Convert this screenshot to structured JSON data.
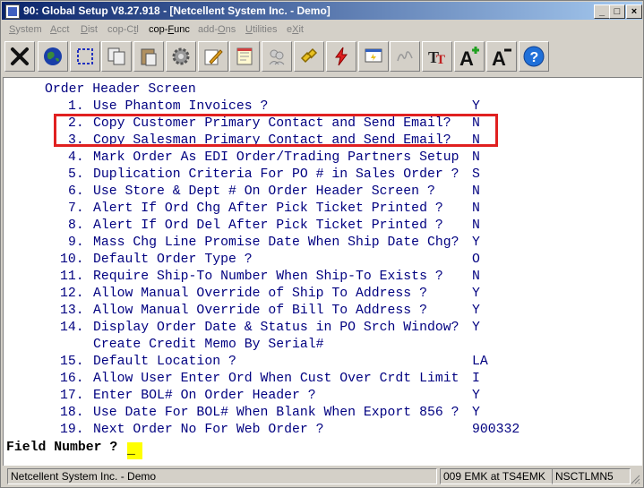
{
  "window": {
    "title": "90: Global Setup V8.27.918 - [Netcellent System Inc. - Demo]",
    "controls": {
      "minimize": "_",
      "maximize": "□",
      "close": "×"
    }
  },
  "menu": [
    {
      "pre": "",
      "ul": "S",
      "post": "ystem"
    },
    {
      "pre": "",
      "ul": "A",
      "post": "cct"
    },
    {
      "pre": "",
      "ul": "D",
      "post": "ist"
    },
    {
      "pre": "cop-C",
      "ul": "t",
      "post": "l"
    },
    {
      "pre": "cop-",
      "ul": "F",
      "post": "unc"
    },
    {
      "pre": "add-",
      "ul": "O",
      "post": "ns"
    },
    {
      "pre": "",
      "ul": "U",
      "post": "tilities"
    },
    {
      "pre": "e",
      "ul": "X",
      "post": "it"
    }
  ],
  "toolbar": {
    "icons": [
      "exit-icon",
      "globe-icon",
      "select-icon",
      "copy-icon",
      "paste-icon",
      "settings-icon",
      "edit-icon",
      "notes-icon",
      "users-icon",
      "link-icon",
      "lightning-icon",
      "screen-icon",
      "signature-icon",
      "font-icon",
      "font-increase-icon",
      "font-decrease-icon",
      "help-icon"
    ]
  },
  "screen": {
    "heading": "Order Header Screen",
    "items": [
      {
        "num": "1.",
        "label": "Use Phantom Invoices ?",
        "value": "Y"
      },
      {
        "num": "2.",
        "label": "Copy Customer Primary Contact and Send Email?",
        "value": "N"
      },
      {
        "num": "3.",
        "label": "Copy Salesman Primary Contact and Send Email?",
        "value": "N"
      },
      {
        "num": "4.",
        "label": "Mark Order As EDI Order/Trading Partners Setup",
        "value": "N"
      },
      {
        "num": "5.",
        "label": "Duplication Criteria For PO # in Sales Order ?",
        "value": "S"
      },
      {
        "num": "6.",
        "label": "Use Store & Dept # On Order Header Screen ?",
        "value": "N"
      },
      {
        "num": "7.",
        "label": "Alert If Ord Chg After Pick Ticket Printed ?",
        "value": "N"
      },
      {
        "num": "8.",
        "label": "Alert If Ord Del After Pick Ticket Printed ?",
        "value": "N"
      },
      {
        "num": "9.",
        "label": "Mass Chg Line Promise Date When Ship Date Chg?",
        "value": "Y"
      },
      {
        "num": "10.",
        "label": "Default Order Type ?",
        "value": "O"
      },
      {
        "num": "11.",
        "label": "Require Ship-To Number When Ship-To Exists ?",
        "value": "N"
      },
      {
        "num": "12.",
        "label": "Allow Manual Override of Ship To Address ?",
        "value": "Y"
      },
      {
        "num": "13.",
        "label": "Allow Manual Override of Bill To Address ?",
        "value": "Y"
      },
      {
        "num": "14.",
        "label": "Display Order Date & Status in PO Srch Window?",
        "value": "Y"
      },
      {
        "num": "",
        "label": "Create Credit Memo By Serial#",
        "value": ""
      },
      {
        "num": "15.",
        "label": "Default Location ?",
        "value": "LA"
      },
      {
        "num": "16.",
        "label": "Allow User Enter Ord When Cust Over Crdt Limit",
        "value": "I"
      },
      {
        "num": "17.",
        "label": "Enter BOL# On Order Header ?",
        "value": "Y"
      },
      {
        "num": "18.",
        "label": "Use Date For BOL# When Blank When Export 856 ?",
        "value": "Y"
      },
      {
        "num": "19.",
        "label": "Next Order No For Web Order ?",
        "value": "900332"
      }
    ],
    "prompt": "Field Number ?",
    "input_value": "_"
  },
  "status": {
    "company": "Netcellent System Inc. - Demo",
    "session": "009 EMK at TS4EMK",
    "user": "NSCTLMN5"
  },
  "colors": {
    "title_bar": "#0a246a",
    "terminal_text": "#000080",
    "highlight_box": "#e02020",
    "input_cursor": "#ffff00"
  }
}
